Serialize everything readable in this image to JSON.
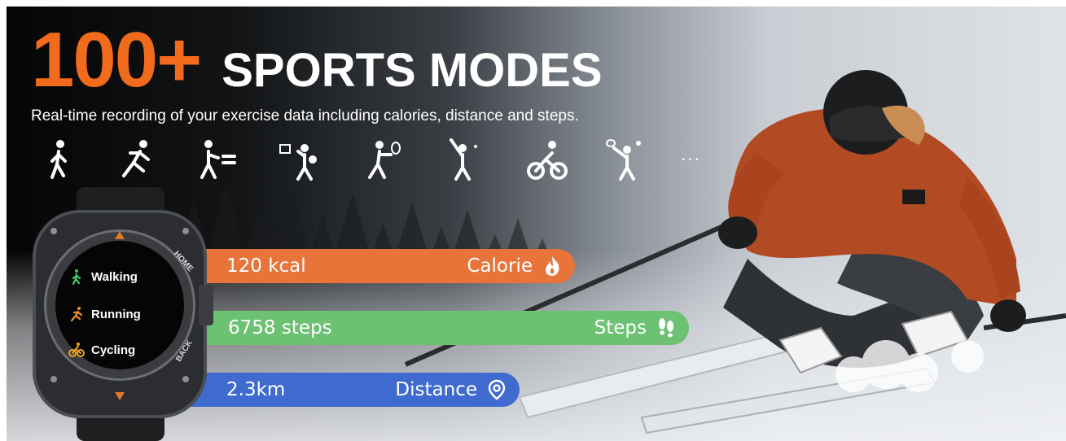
{
  "headline": {
    "number": "100+",
    "title": "SPORTS MODES"
  },
  "subtitle": "Real-time recording of your exercise data including calories, distance and steps.",
  "sports_icons": [
    "walking-icon",
    "running-icon",
    "table-tennis-icon",
    "basketball-icon",
    "tennis-icon",
    "baseball-icon",
    "cycling-icon",
    "badminton-icon"
  ],
  "more_indicator": "...",
  "watch": {
    "modes": [
      {
        "label": "Walking",
        "icon": "walking-icon",
        "color": "#3ccf6a"
      },
      {
        "label": "Running",
        "icon": "running-icon",
        "color": "#f08a24"
      },
      {
        "label": "Cycling",
        "icon": "cycling-icon",
        "color": "#f3a21a"
      }
    ],
    "button_labels": {
      "home": "HOME",
      "back": "BACK"
    }
  },
  "stats": {
    "calorie": {
      "value": "120 kcal",
      "label": "Calorie",
      "icon": "flame-icon",
      "color": "#e8743a"
    },
    "steps": {
      "value": "6758 steps",
      "label": "Steps",
      "icon": "footprints-icon",
      "color": "#6cc173"
    },
    "distance": {
      "value": "2.3km",
      "label": "Distance",
      "icon": "location-pin-icon",
      "color": "#3f6bd0"
    }
  },
  "colors": {
    "accent_orange": "#f26a1b",
    "text_white": "#ffffff"
  }
}
